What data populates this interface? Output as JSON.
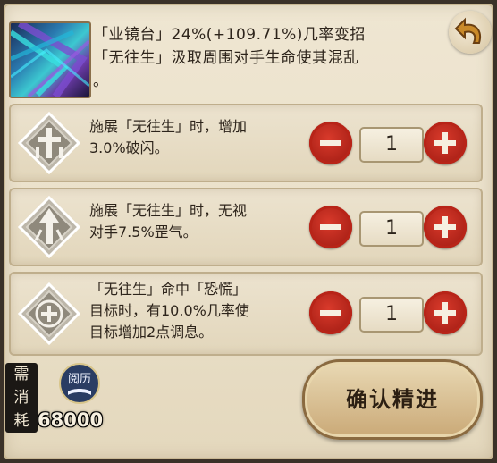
{
  "skill": {
    "description": "「业镜台」24%(+109.71%)几率变招\n「无往生」汲取周围对手生命使其混乱\n。"
  },
  "rows": [
    {
      "icon": "cross-buff-icon",
      "text": "施展「无往生」时，增加\n3.0%破闪。",
      "count": "1"
    },
    {
      "icon": "arrow-up-icon",
      "text": "施展「无往生」时，无视\n对手7.5%罡气。",
      "count": "1"
    },
    {
      "icon": "plus-icon",
      "text": "「无往生」命中「恐慌」\n目标时，有10.0%几率使\n目标增加2点调息。",
      "count": "1"
    }
  ],
  "cost": {
    "label_chars": [
      "需",
      "消",
      "耗"
    ],
    "currency_icon_text": "阅历",
    "amount": "68000"
  },
  "confirm_label": "确认精进",
  "colors": {
    "accent_red": "#c22a1c",
    "panel_bg": "#ebe2cd",
    "text": "#2d241b"
  }
}
